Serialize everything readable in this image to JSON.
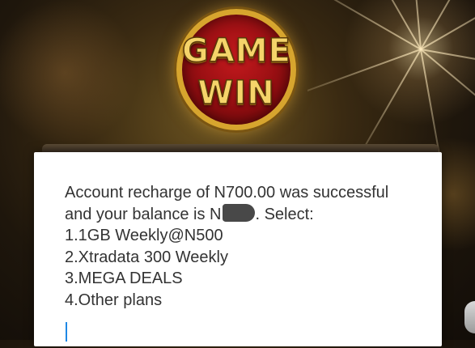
{
  "background": {
    "logo": {
      "top_word": "GAME",
      "bottom_word": "WIN",
      "colors": {
        "text": "#f5d46a",
        "disc": "#c4191d",
        "rim": "#d7a52e"
      }
    }
  },
  "dialog": {
    "message_line1": "Account recharge of N700.00 was successful",
    "message_line2_before": "and your balance is N",
    "message_line2_after": ". Select:",
    "options": [
      "1.1GB Weekly@N500",
      "2.Xtradata 300 Weekly",
      "3.MEGA DEALS",
      "4.Other plans"
    ],
    "reply_input": {
      "value": "",
      "placeholder": ""
    },
    "cursor_color": "#1e88e5"
  }
}
